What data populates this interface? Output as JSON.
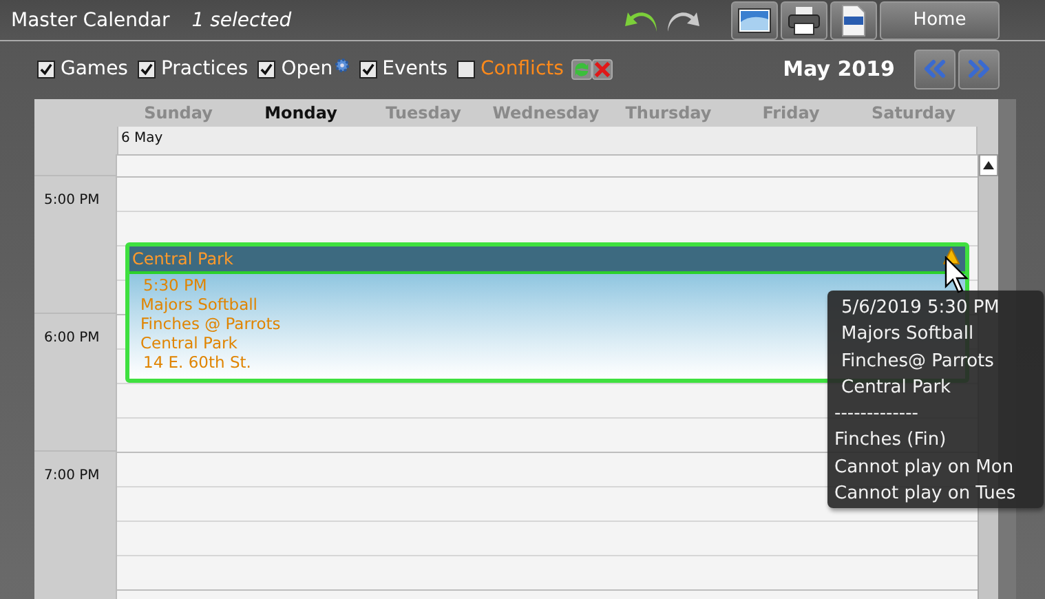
{
  "window": {
    "title": "Master Calendar",
    "selection": "1 selected"
  },
  "home_button": "Home",
  "filters": [
    {
      "label": "Games",
      "checked": true,
      "kind": "plain"
    },
    {
      "label": "Practices",
      "checked": true,
      "kind": "plain"
    },
    {
      "label": "Open",
      "checked": true,
      "kind": "settings"
    },
    {
      "label": "Events",
      "checked": true,
      "kind": "plain"
    },
    {
      "label": "Conflicts",
      "checked": false,
      "kind": "conflicts"
    }
  ],
  "month": "May 2019",
  "days": [
    {
      "label": "Sunday",
      "selected": false
    },
    {
      "label": "Monday",
      "selected": true
    },
    {
      "label": "Tuesday",
      "selected": false
    },
    {
      "label": "Wednesday",
      "selected": false
    },
    {
      "label": "Thursday",
      "selected": false
    },
    {
      "label": "Friday",
      "selected": false
    },
    {
      "label": "Saturday",
      "selected": false
    }
  ],
  "date_label": "6 May",
  "times": [
    "5:00 PM",
    "6:00 PM",
    "7:00 PM"
  ],
  "event": {
    "title": "Central Park",
    "lines": [
      "5:30 PM",
      "Majors Softball",
      "Finches @ Parrots",
      "Central Park",
      "14 E. 60th St."
    ],
    "selected": true,
    "warning": true
  },
  "tooltip": {
    "header": [
      "5/6/2019 5:30 PM",
      "Majors Softball",
      "Finches@ Parrots",
      "Central Park"
    ],
    "separator": "-------------",
    "details": [
      "Finches (Fin)",
      "Cannot play on Mon",
      "Cannot play on Tues"
    ]
  }
}
